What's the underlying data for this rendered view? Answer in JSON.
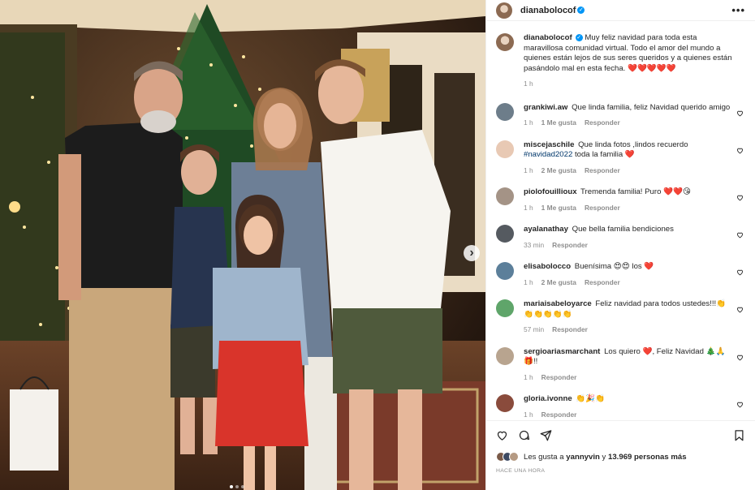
{
  "post": {
    "author": "dianabolocof",
    "caption": "Muy feliz navidad para toda esta maravillosa comunidad virtual. Todo el amor del mundo a quienes están lejos de sus seres queridos y a quienes están pasándolo mal en esta fecha. ❤️❤️❤️❤️❤️",
    "caption_time": "1 h",
    "more_icon": "•••",
    "verified_icon": "✓",
    "next_icon": "›"
  },
  "comments": [
    {
      "user": "grankiwi.aw",
      "text": "Que linda familia, feliz Navidad querido amigo",
      "time": "1 h",
      "likes": "1 Me gusta",
      "reply": "Responder",
      "avatar_color": "#6d7d8a"
    },
    {
      "user": "miscejaschile",
      "text_before": "Que linda fotos ,lindos recuerdo ",
      "hashtag": "#navidad2022",
      "text_after": " toda la familia ❤️",
      "time": "1 h",
      "likes": "2 Me gusta",
      "reply": "Responder",
      "avatar_color": "#e8c9b4"
    },
    {
      "user": "piolofouillioux",
      "text": "Tremenda familia! Puro ❤️❤️😘",
      "time": "1 h",
      "likes": "1 Me gusta",
      "reply": "Responder",
      "avatar_color": "#a49386"
    },
    {
      "user": "ayalanathay",
      "text": "Que bella familia bendiciones",
      "time": "33 min",
      "likes": "",
      "reply": "Responder",
      "avatar_color": "#555a60"
    },
    {
      "user": "elisabolocco",
      "text": "Buenísima 😍😍 los ❤️",
      "time": "1 h",
      "likes": "2 Me gusta",
      "reply": "Responder",
      "avatar_color": "#5c7f9a"
    },
    {
      "user": "mariaisabeloyarce",
      "text": "Feliz navidad para todos ustedes!!!👏👏👏👏👏👏",
      "time": "57 min",
      "likes": "",
      "reply": "Responder",
      "avatar_color": "#5fa56a"
    },
    {
      "user": "sergioariasmarchant",
      "text": "Los quiero ❤️, Feliz Navidad 🎄🙏🎁!!",
      "time": "1 h",
      "likes": "",
      "reply": "Responder",
      "avatar_color": "#b8a48f"
    },
    {
      "user": "gloria.ivonne",
      "text": "👏🎉👏",
      "time": "1 h",
      "likes": "",
      "reply": "Responder",
      "avatar_color": "#8a4b3c"
    }
  ],
  "likes": {
    "prefix": "Les gusta a",
    "user": "yannyvin",
    "middle": "y",
    "count": "13.969 personas más"
  },
  "time_ago": "HACE UNA HORA",
  "colors": {
    "link": "#00376b",
    "muted": "#8e8e8e",
    "verified": "#0095f6",
    "heart": "#ed4956"
  }
}
